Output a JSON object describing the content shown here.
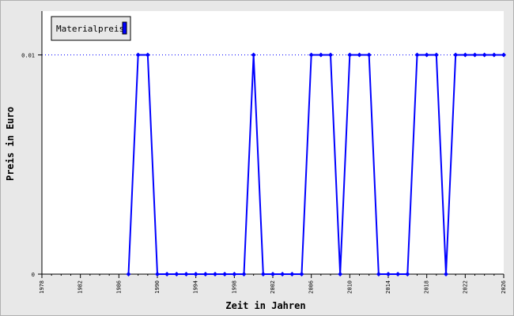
{
  "chart_data": {
    "type": "line",
    "title": "",
    "xlabel": "Zeit in Jahren",
    "ylabel": "Preis in Euro",
    "x_ticks": [
      1978,
      1982,
      1986,
      1990,
      1994,
      1998,
      2002,
      2006,
      2010,
      2014,
      2018,
      2022,
      2026
    ],
    "xlim": [
      1978,
      2026
    ],
    "y_ticks": [
      {
        "value": 0,
        "label": "0"
      },
      {
        "value": 0.01,
        "label": "0.01"
      }
    ],
    "ylim": [
      0,
      0.012
    ],
    "grid": "dotted line at 0.01",
    "legend_position": "top-left",
    "series": [
      {
        "name": "Materialpreis",
        "color": "#0000ff",
        "points": [
          [
            1987,
            0
          ],
          [
            1988,
            0.01
          ],
          [
            1989,
            0.01
          ],
          [
            1990,
            0
          ],
          [
            1991,
            0
          ],
          [
            1992,
            0
          ],
          [
            1993,
            0
          ],
          [
            1994,
            0
          ],
          [
            1995,
            0
          ],
          [
            1996,
            0
          ],
          [
            1997,
            0
          ],
          [
            1998,
            0
          ],
          [
            1999,
            0
          ],
          [
            2000,
            0.01
          ],
          [
            2001,
            0
          ],
          [
            2002,
            0
          ],
          [
            2003,
            0
          ],
          [
            2004,
            0
          ],
          [
            2005,
            0
          ],
          [
            2006,
            0.01
          ],
          [
            2007,
            0.01
          ],
          [
            2008,
            0.01
          ],
          [
            2009,
            0
          ],
          [
            2010,
            0.01
          ],
          [
            2011,
            0.01
          ],
          [
            2012,
            0.01
          ],
          [
            2013,
            0
          ],
          [
            2014,
            0
          ],
          [
            2015,
            0
          ],
          [
            2016,
            0
          ],
          [
            2017,
            0.01
          ],
          [
            2018,
            0.01
          ],
          [
            2019,
            0.01
          ],
          [
            2020,
            0
          ],
          [
            2021,
            0.01
          ],
          [
            2022,
            0.01
          ],
          [
            2023,
            0.01
          ],
          [
            2024,
            0.01
          ],
          [
            2025,
            0.01
          ],
          [
            2026,
            0.01
          ]
        ]
      }
    ]
  }
}
